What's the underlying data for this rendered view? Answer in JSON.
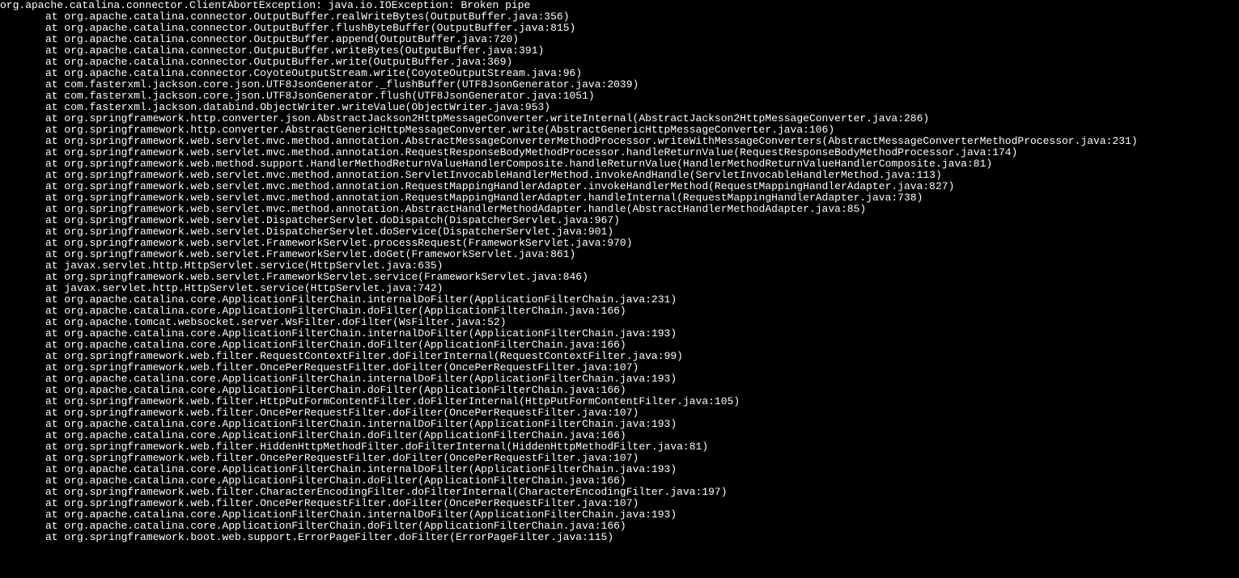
{
  "exception": "org.apache.catalina.connector.ClientAbortException: java.io.IOException: Broken pipe",
  "frames": [
    "org.apache.catalina.connector.OutputBuffer.realWriteBytes(OutputBuffer.java:356)",
    "org.apache.catalina.connector.OutputBuffer.flushByteBuffer(OutputBuffer.java:815)",
    "org.apache.catalina.connector.OutputBuffer.append(OutputBuffer.java:720)",
    "org.apache.catalina.connector.OutputBuffer.writeBytes(OutputBuffer.java:391)",
    "org.apache.catalina.connector.OutputBuffer.write(OutputBuffer.java:369)",
    "org.apache.catalina.connector.CoyoteOutputStream.write(CoyoteOutputStream.java:96)",
    "com.fasterxml.jackson.core.json.UTF8JsonGenerator._flushBuffer(UTF8JsonGenerator.java:2039)",
    "com.fasterxml.jackson.core.json.UTF8JsonGenerator.flush(UTF8JsonGenerator.java:1051)",
    "com.fasterxml.jackson.databind.ObjectWriter.writeValue(ObjectWriter.java:953)",
    "org.springframework.http.converter.json.AbstractJackson2HttpMessageConverter.writeInternal(AbstractJackson2HttpMessageConverter.java:286)",
    "org.springframework.http.converter.AbstractGenericHttpMessageConverter.write(AbstractGenericHttpMessageConverter.java:106)",
    "org.springframework.web.servlet.mvc.method.annotation.AbstractMessageConverterMethodProcessor.writeWithMessageConverters(AbstractMessageConverterMethodProcessor.java:231)",
    "org.springframework.web.servlet.mvc.method.annotation.RequestResponseBodyMethodProcessor.handleReturnValue(RequestResponseBodyMethodProcessor.java:174)",
    "org.springframework.web.method.support.HandlerMethodReturnValueHandlerComposite.handleReturnValue(HandlerMethodReturnValueHandlerComposite.java:81)",
    "org.springframework.web.servlet.mvc.method.annotation.ServletInvocableHandlerMethod.invokeAndHandle(ServletInvocableHandlerMethod.java:113)",
    "org.springframework.web.servlet.mvc.method.annotation.RequestMappingHandlerAdapter.invokeHandlerMethod(RequestMappingHandlerAdapter.java:827)",
    "org.springframework.web.servlet.mvc.method.annotation.RequestMappingHandlerAdapter.handleInternal(RequestMappingHandlerAdapter.java:738)",
    "org.springframework.web.servlet.mvc.method.annotation.AbstractHandlerMethodAdapter.handle(AbstractHandlerMethodAdapter.java:85)",
    "org.springframework.web.servlet.DispatcherServlet.doDispatch(DispatcherServlet.java:967)",
    "org.springframework.web.servlet.DispatcherServlet.doService(DispatcherServlet.java:901)",
    "org.springframework.web.servlet.FrameworkServlet.processRequest(FrameworkServlet.java:970)",
    "org.springframework.web.servlet.FrameworkServlet.doGet(FrameworkServlet.java:861)",
    "javax.servlet.http.HttpServlet.service(HttpServlet.java:635)",
    "org.springframework.web.servlet.FrameworkServlet.service(FrameworkServlet.java:846)",
    "javax.servlet.http.HttpServlet.service(HttpServlet.java:742)",
    "org.apache.catalina.core.ApplicationFilterChain.internalDoFilter(ApplicationFilterChain.java:231)",
    "org.apache.catalina.core.ApplicationFilterChain.doFilter(ApplicationFilterChain.java:166)",
    "org.apache.tomcat.websocket.server.WsFilter.doFilter(WsFilter.java:52)",
    "org.apache.catalina.core.ApplicationFilterChain.internalDoFilter(ApplicationFilterChain.java:193)",
    "org.apache.catalina.core.ApplicationFilterChain.doFilter(ApplicationFilterChain.java:166)",
    "org.springframework.web.filter.RequestContextFilter.doFilterInternal(RequestContextFilter.java:99)",
    "org.springframework.web.filter.OncePerRequestFilter.doFilter(OncePerRequestFilter.java:107)",
    "org.apache.catalina.core.ApplicationFilterChain.internalDoFilter(ApplicationFilterChain.java:193)",
    "org.apache.catalina.core.ApplicationFilterChain.doFilter(ApplicationFilterChain.java:166)",
    "org.springframework.web.filter.HttpPutFormContentFilter.doFilterInternal(HttpPutFormContentFilter.java:105)",
    "org.springframework.web.filter.OncePerRequestFilter.doFilter(OncePerRequestFilter.java:107)",
    "org.apache.catalina.core.ApplicationFilterChain.internalDoFilter(ApplicationFilterChain.java:193)",
    "org.apache.catalina.core.ApplicationFilterChain.doFilter(ApplicationFilterChain.java:166)",
    "org.springframework.web.filter.HiddenHttpMethodFilter.doFilterInternal(HiddenHttpMethodFilter.java:81)",
    "org.springframework.web.filter.OncePerRequestFilter.doFilter(OncePerRequestFilter.java:107)",
    "org.apache.catalina.core.ApplicationFilterChain.internalDoFilter(ApplicationFilterChain.java:193)",
    "org.apache.catalina.core.ApplicationFilterChain.doFilter(ApplicationFilterChain.java:166)",
    "org.springframework.web.filter.CharacterEncodingFilter.doFilterInternal(CharacterEncodingFilter.java:197)",
    "org.springframework.web.filter.OncePerRequestFilter.doFilter(OncePerRequestFilter.java:107)",
    "org.apache.catalina.core.ApplicationFilterChain.internalDoFilter(ApplicationFilterChain.java:193)",
    "org.apache.catalina.core.ApplicationFilterChain.doFilter(ApplicationFilterChain.java:166)",
    "org.springframework.boot.web.support.ErrorPageFilter.doFilter(ErrorPageFilter.java:115)"
  ]
}
